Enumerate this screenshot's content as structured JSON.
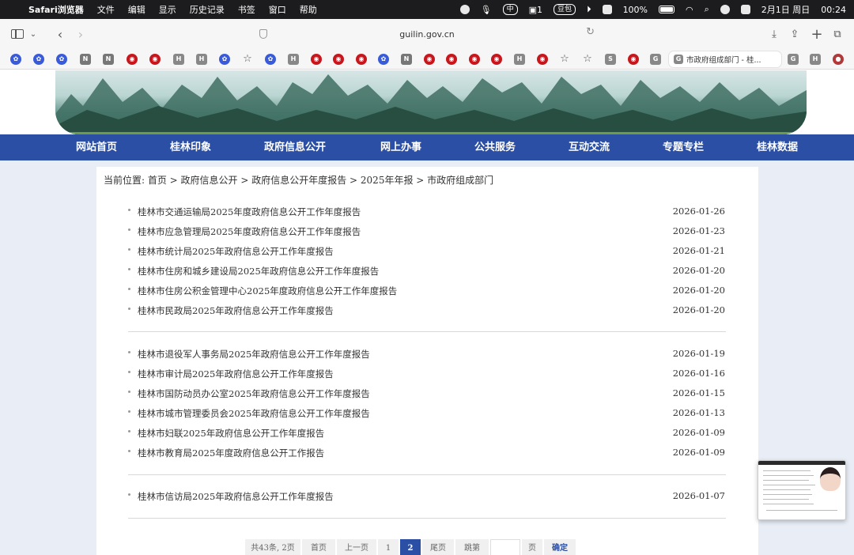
{
  "menubar": {
    "app_name": "Safari浏览器",
    "menus": [
      "文件",
      "编辑",
      "显示",
      "历史记录",
      "书签",
      "窗口",
      "帮助"
    ],
    "status_badge": "豆包",
    "input_method": "中",
    "wechat_count": "1",
    "battery": "100%",
    "date": "2月1日 周日",
    "time": "00:24"
  },
  "toolbar": {
    "url": "guilin.gov.cn"
  },
  "favorites": {
    "active_tab_icon_letter": "G",
    "active_tab_title": "市政府组成部门 - 桂..."
  },
  "nav": {
    "items": [
      "网站首页",
      "桂林印象",
      "政府信息公开",
      "网上办事",
      "公共服务",
      "互动交流",
      "专题专栏",
      "桂林数据"
    ]
  },
  "breadcrumb": "当前位置:  首页 > 政府信息公开 > 政府信息公开年度报告 > 2025年年报 > 市政府组成部门",
  "reports": [
    {
      "title": "桂林市交通运输局2025年度政府信息公开工作年度报告",
      "date": "2026-01-26"
    },
    {
      "title": "桂林市应急管理局2025年度政府信息公开工作年度报告",
      "date": "2026-01-23"
    },
    {
      "title": "桂林市统计局2025年政府信息公开工作年度报告",
      "date": "2026-01-21"
    },
    {
      "title": "桂林市住房和城乡建设局2025年政府信息公开工作年度报告",
      "date": "2026-01-20"
    },
    {
      "title": "桂林市住房公积金管理中心2025年度政府信息公开工作年度报告",
      "date": "2026-01-20"
    },
    {
      "title": "桂林市民政局2025年政府信息公开工作年度报告",
      "date": "2026-01-20"
    },
    {
      "title": "桂林市退役军人事务局2025年政府信息公开工作年度报告",
      "date": "2026-01-19"
    },
    {
      "title": "桂林市审计局2025年政府信息公开工作年度报告",
      "date": "2026-01-16"
    },
    {
      "title": "桂林市国防动员办公室2025年政府信息公开工作年度报告",
      "date": "2026-01-15"
    },
    {
      "title": "桂林市城市管理委员会2025年政府信息公开工作年度报告",
      "date": "2026-01-13"
    },
    {
      "title": "桂林市妇联2025年政府信息公开工作年度报告",
      "date": "2026-01-09"
    },
    {
      "title": "桂林市教育局2025年度政府信息公开工作报告",
      "date": "2026-01-09"
    },
    {
      "title": "桂林市信访局2025年政府信息公开工作年度报告",
      "date": "2026-01-07"
    }
  ],
  "pager": {
    "summary": "共43条, 2页",
    "first": "首页",
    "prev": "上一页",
    "page1": "1",
    "page2": "2",
    "last": "尾页",
    "jump": "跳第",
    "page_unit": "页",
    "confirm": "确定"
  }
}
